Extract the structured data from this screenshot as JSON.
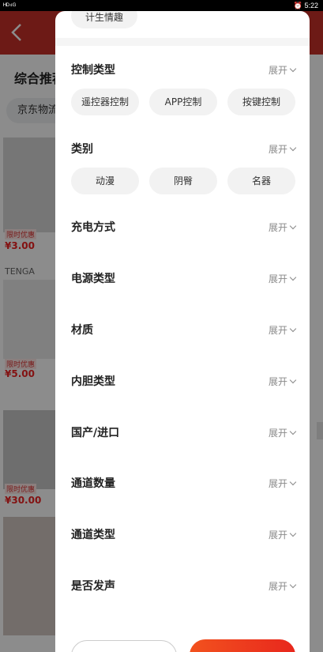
{
  "status_bar": {
    "left": "ᴴᴰ⁴ᴳ",
    "right": "⏰ 5:22"
  },
  "background_app": {
    "title": "综合推荐",
    "chip": "京东物流",
    "cards": [
      {
        "badge": "限时优惠",
        "price": "¥3.00"
      },
      {
        "brand": "TENGA",
        "badge": "限时优惠",
        "price": "¥5.00"
      },
      {
        "badge": "限时优惠",
        "price": "¥30.00"
      }
    ]
  },
  "filter_panel": {
    "prev_chip": "计生情趣",
    "sections": [
      {
        "title": "控制类型",
        "expand": "展开",
        "chips": [
          "遥控器控制",
          "APP控制",
          "按键控制"
        ]
      },
      {
        "title": "类别",
        "expand": "展开",
        "chips": [
          "动漫",
          "阴臀",
          "名器"
        ]
      },
      {
        "title": "充电方式",
        "expand": "展开",
        "chips": []
      },
      {
        "title": "电源类型",
        "expand": "展开",
        "chips": []
      },
      {
        "title": "材质",
        "expand": "展开",
        "chips": []
      },
      {
        "title": "内胆类型",
        "expand": "展开",
        "chips": []
      },
      {
        "title": "国产/进口",
        "expand": "展开",
        "chips": []
      },
      {
        "title": "通道数量",
        "expand": "展开",
        "chips": []
      },
      {
        "title": "通道类型",
        "expand": "展开",
        "chips": []
      },
      {
        "title": "是否发声",
        "expand": "展开",
        "chips": []
      }
    ]
  },
  "colors": {
    "accent": "#e8271d",
    "header_red": "#c73128",
    "chip_bg": "#f2f2f2"
  }
}
